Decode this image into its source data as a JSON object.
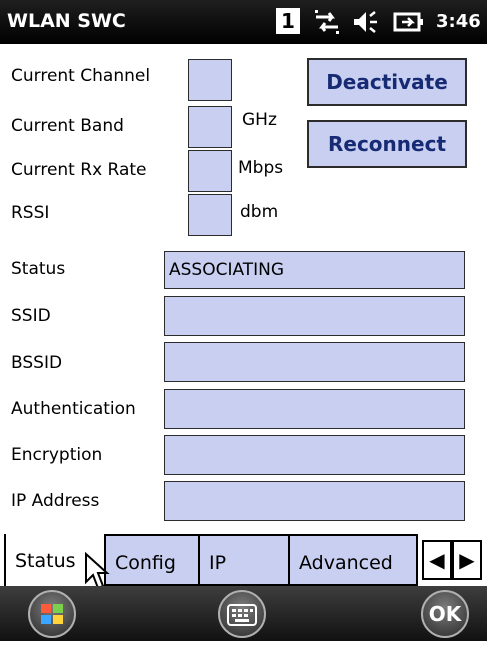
{
  "title_bar": {
    "title": "WLAN SWC",
    "indicator": "1",
    "connectivity_icon": "sync-arrows-icon",
    "volume_icon": "speaker-icon",
    "battery_icon": "battery-charging-icon",
    "time": "3:46"
  },
  "stats": {
    "current_channel_label": "Current Channel",
    "current_band_label": "Current Band",
    "current_band_unit": "GHz",
    "current_rx_rate_label": "Current Rx Rate",
    "current_rx_rate_unit": "Mbps",
    "rssi_label": "RSSI",
    "rssi_unit": "dbm"
  },
  "actions": {
    "deactivate": "Deactivate",
    "reconnect": "Reconnect"
  },
  "fields": {
    "status_label": "Status",
    "status_value": "ASSOCIATING",
    "ssid_label": "SSID",
    "bssid_label": "BSSID",
    "authentication_label": "Authentication",
    "encryption_label": "Encryption",
    "ip_address_label": "IP Address"
  },
  "tabs": {
    "status": "Status",
    "config": "Config",
    "ip": "IP",
    "advanced": "Advanced",
    "left_arrow": "◀",
    "right_arrow": "▶"
  },
  "bottom": {
    "start_icon": "windows-start-icon",
    "keyboard_icon": "keyboard-icon",
    "ok": "OK"
  },
  "colors": {
    "field_bg": "#c9cff1",
    "button_text": "#172b74",
    "title_bar_bg": "#000000"
  }
}
